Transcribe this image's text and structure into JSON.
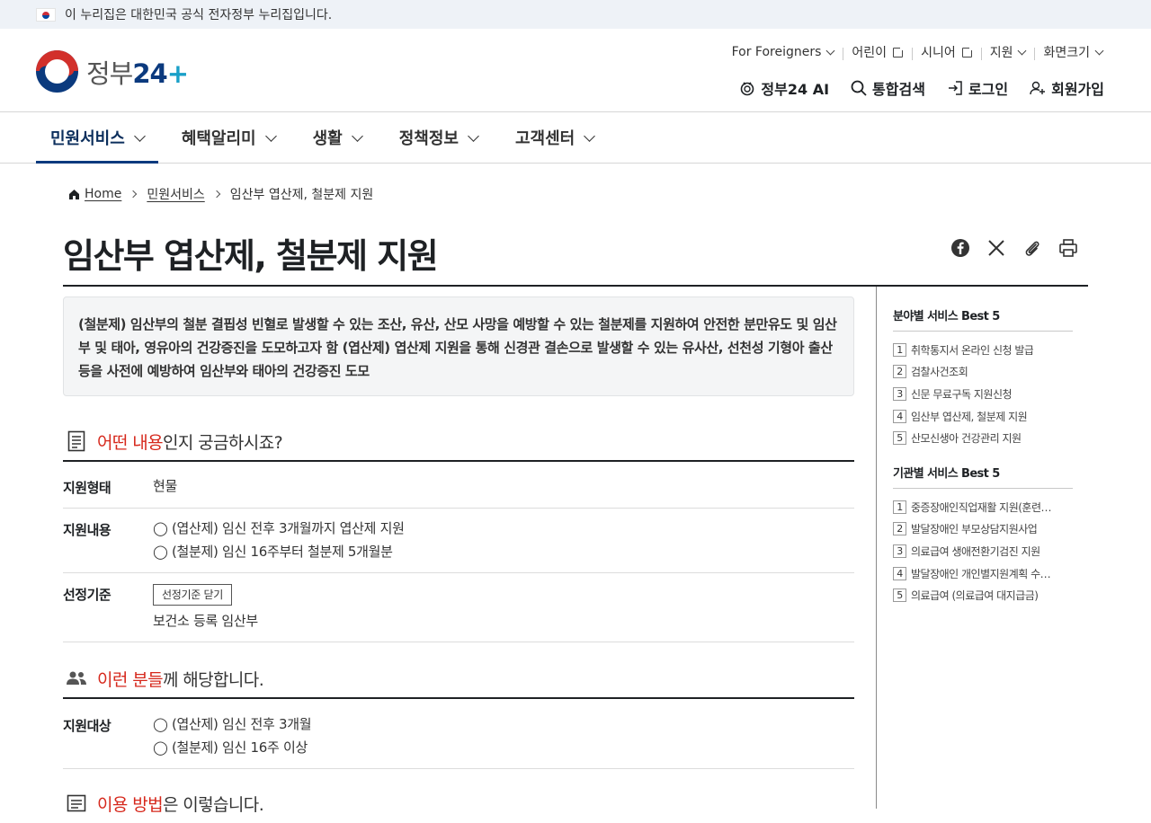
{
  "gov_banner": {
    "text": "이 누리집은 대한민국 공식 전자정부 누리집입니다."
  },
  "logo": {
    "text": "정부",
    "num": "24",
    "plus": "+"
  },
  "util_nav": [
    {
      "label": "For Foreigners",
      "icon": "chevron-down-icon"
    },
    {
      "label": "어린이",
      "icon": "external-link-icon"
    },
    {
      "label": "시니어",
      "icon": "external-link-icon"
    },
    {
      "label": "지원",
      "icon": "chevron-down-icon"
    },
    {
      "label": "화면크기",
      "icon": "chevron-down-icon"
    }
  ],
  "main_util": [
    {
      "label": "정부24 AI",
      "icon": "ai-icon"
    },
    {
      "label": "통합검색",
      "icon": "search-icon"
    },
    {
      "label": "로그인",
      "icon": "login-icon"
    },
    {
      "label": "회원가입",
      "icon": "user-plus-icon"
    }
  ],
  "gnb": [
    {
      "label": "민원서비스",
      "active": true
    },
    {
      "label": "혜택알리미",
      "active": false
    },
    {
      "label": "생활",
      "active": false
    },
    {
      "label": "정책정보",
      "active": false
    },
    {
      "label": "고객센터",
      "active": false
    }
  ],
  "breadcrumb": [
    "Home",
    "민원서비스",
    "임산부 엽산제, 철분제 지원"
  ],
  "page_title": "임산부 엽산제, 철분제 지원",
  "share_icons": [
    "facebook-icon",
    "x-icon",
    "link-icon",
    "print-icon"
  ],
  "summary": "(철분제) 임산부의 철분 결핍성 빈혈로 발생할 수 있는 조산, 유산, 산모 사망을 예방할 수 있는 철분제를 지원하여 안전한 분만유도 및 임산부 및 태아, 영유아의 건강증진을 도모하고자 함 (엽산제) 엽산제 지원을 통해 신경관 결손으로 발생할 수 있는 유사산, 선천성 기형아 출산 등을 사전에 예방하여 임산부와 태아의 건강증진 도모",
  "section1": {
    "title_red": "어떤 내용",
    "title_rest": "인지 궁금하시죠?",
    "rows": [
      {
        "label": "지원형태",
        "lines": [
          "현물"
        ]
      },
      {
        "label": "지원내용",
        "lines": [
          "◯ (엽산제) 임신 전후 3개월까지 엽산제 지원",
          "◯ (철분제) 임신 16주부터 철분제 5개월분"
        ]
      },
      {
        "label": "선정기준",
        "button": "선정기준 닫기",
        "lines": [
          "보건소 등록 임산부"
        ]
      }
    ]
  },
  "section2": {
    "title_red": "이런 분들",
    "title_rest": "께 해당합니다.",
    "rows": [
      {
        "label": "지원대상",
        "lines": [
          "◯ (엽산제) 임신 전후 3개월",
          "◯ (철분제) 임신 16주 이상"
        ]
      }
    ]
  },
  "section3": {
    "title_red": "이용 방법",
    "title_rest": "은 이렇습니다."
  },
  "sidebar": {
    "field_best": {
      "title": "분야별 서비스 Best 5",
      "items": [
        "취학통지서 온라인 신청 발급",
        "검찰사건조회",
        "신문 무료구독 지원신청",
        "임산부 엽산제, 철분제 지원",
        "산모신생아 건강관리 지원"
      ]
    },
    "org_best": {
      "title": "기관별 서비스 Best 5",
      "items": [
        "중증장애인직업재활 지원(훈련수…",
        "발달장애인 부모상담지원사업",
        "의료급여 생애전환기검진 지원",
        "발달장애인 개인별지원계획 수립…",
        "의료급여 (의료급여 대지급금)"
      ]
    }
  },
  "colors": {
    "accent_red": "#d6281c",
    "brand_navy": "#0b3a7e",
    "rule": "#1e2124"
  }
}
